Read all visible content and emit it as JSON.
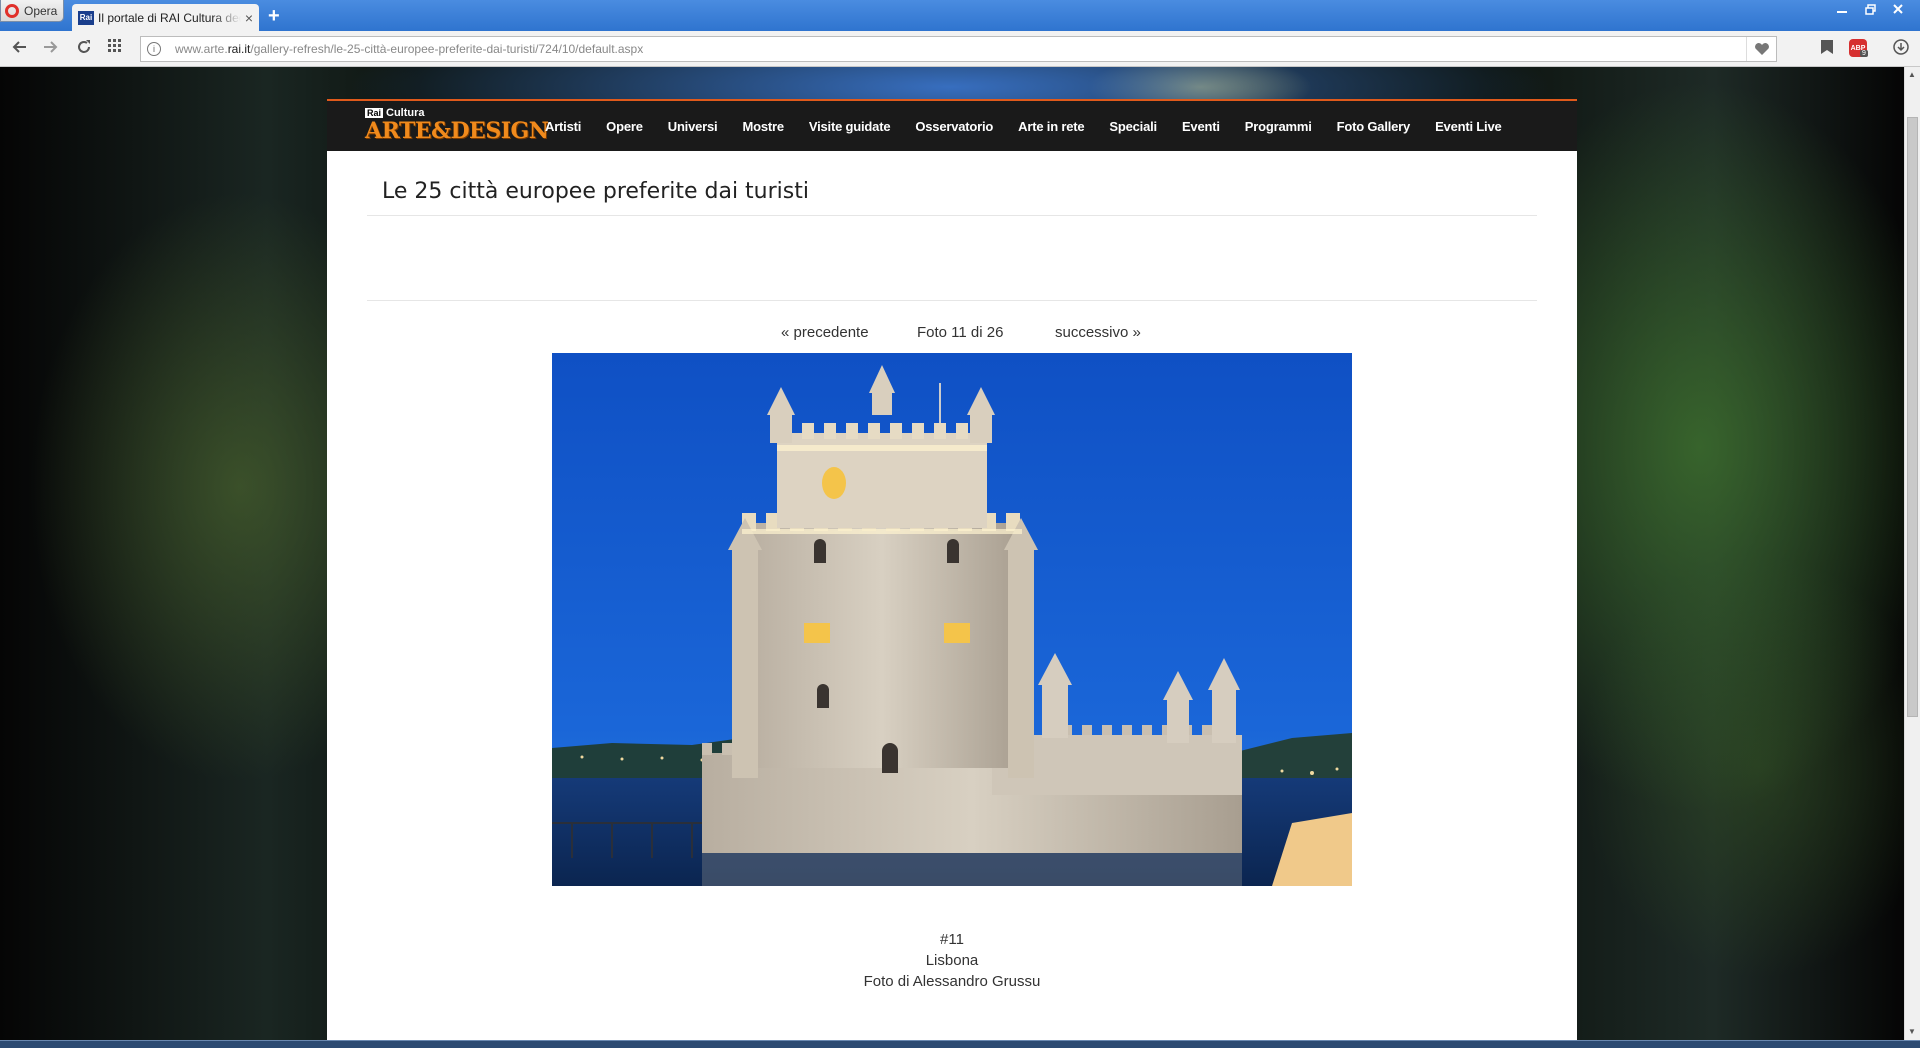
{
  "browser": {
    "menu_label": "Opera",
    "tab_favicon": "Rai",
    "tab_title": "Il portale di RAI Cultura dedicato all'arte",
    "tab_close": "×",
    "new_tab": "+",
    "url_prefix": "www.arte.",
    "url_domain": "rai.it",
    "url_path": "/gallery-refresh/le-25-città-europee-preferite-dai-turisti/724/10/default.aspx",
    "adblock_label": "ABP",
    "adblock_count": "9"
  },
  "site": {
    "logo_small_rai": "Rai",
    "logo_small": "Cultura",
    "logo_main": "ARTE&DESIGN",
    "menu": [
      "Artisti",
      "Opere",
      "Universi",
      "Mostre",
      "Visite guidate",
      "Osservatorio",
      "Arte in rete",
      "Speciali",
      "Eventi",
      "Programmi",
      "Foto Gallery",
      "Eventi Live"
    ]
  },
  "gallery": {
    "title": "Le 25 città europee preferite dai turisti",
    "prev": "« precedente",
    "counter": "Foto 11 di 26",
    "next": "successivo »",
    "number": "#11",
    "city": "Lisbona",
    "credit": "Foto di Alessandro Grussu"
  },
  "icons": {
    "back": "back-arrow-icon",
    "forward": "forward-arrow-icon",
    "reload": "reload-icon",
    "speed_dial": "grid-icon",
    "site_info": "info-icon",
    "bookmark_heart": "heart-icon",
    "bookmarks": "bookmark-icon",
    "download": "download-icon"
  },
  "colors": {
    "accent": "#e05a1b",
    "header": "#1a1a1a",
    "logo": "#f08a1c",
    "sky": "#1658c8"
  }
}
